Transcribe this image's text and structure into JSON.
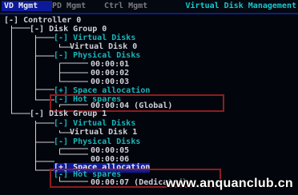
{
  "menu": {
    "tabs": [
      {
        "label": "VD Mgmt",
        "active": true
      },
      {
        "label": "PD Mgmt",
        "active": false
      },
      {
        "label": "Ctrl Mgmt",
        "active": false
      }
    ],
    "title": "Virtual Disk Management"
  },
  "tree": {
    "controller": "[-] Controller 0",
    "group0": {
      "label": "[-] Disk Group 0",
      "virtual_disks": "[-] Virtual Disks",
      "vd": "Virtual Disk 0",
      "physical_disks": "[-] Physical Disks",
      "pd": [
        "00:00:01",
        "00:00:02",
        "00:00:03"
      ],
      "space_allocation": "[+] Space allocation",
      "hot_spares": "[-] Hot spares",
      "hot_spare_disk": "00:00:04 (Global)"
    },
    "group1": {
      "label": "[-] Disk Group 1",
      "virtual_disks": "[-] Virtual Disks",
      "vd": "Virtual Disk 1",
      "physical_disks": "[-] Physical Disks",
      "pd": [
        "00:00:05",
        "00:00:06"
      ],
      "space_allocation": "[+] Space allocation",
      "hot_spares": "[-] Hot spares",
      "hot_spare_disk": "00:00:07 (Dedicated)"
    }
  },
  "watermark": "www.anquanclub.cn",
  "colors": {
    "background": "#02050c",
    "selection": "#0c1a9a",
    "tree_white": "#d0d0d8",
    "tree_cyan": "#17b6ba",
    "highlight_box": "#8e1c20"
  }
}
